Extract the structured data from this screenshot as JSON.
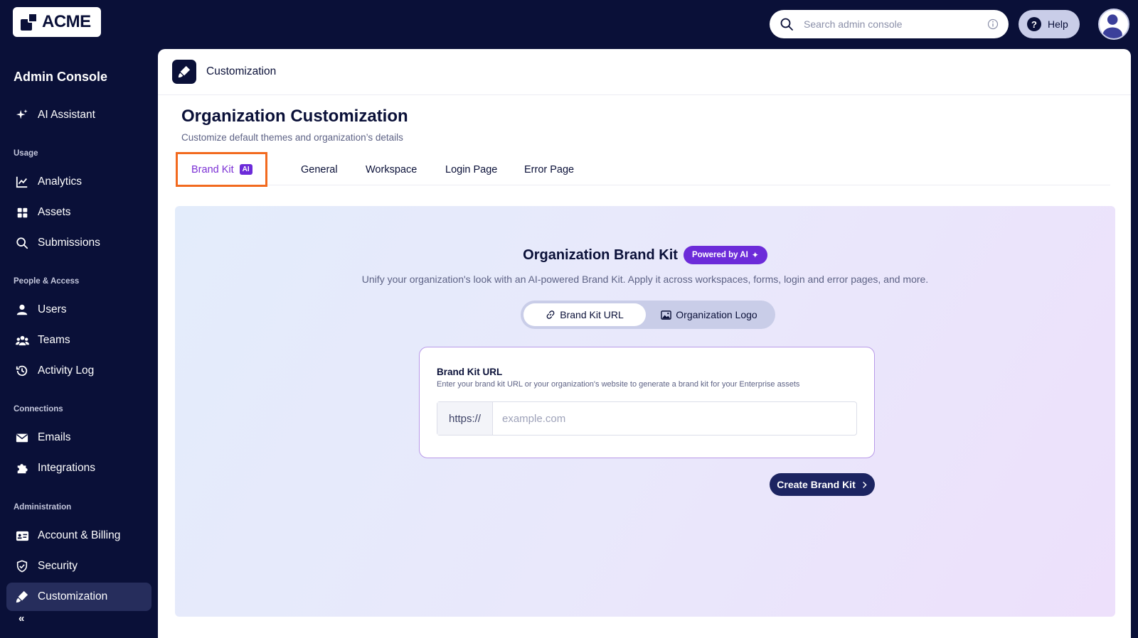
{
  "header": {
    "logo_text": "ACME",
    "search_placeholder": "Search admin console",
    "help_label": "Help"
  },
  "sidebar": {
    "title": "Admin Console",
    "top_item": "AI Assistant",
    "sections": {
      "usage": "Usage",
      "people": "People & Access",
      "connections": "Connections",
      "administration": "Administration"
    },
    "items": {
      "analytics": "Analytics",
      "assets": "Assets",
      "submissions": "Submissions",
      "users": "Users",
      "teams": "Teams",
      "activity_log": "Activity Log",
      "emails": "Emails",
      "integrations": "Integrations",
      "account_billing": "Account & Billing",
      "security": "Security",
      "customization": "Customization"
    }
  },
  "main": {
    "breadcrumb": "Customization",
    "title": "Organization Customization",
    "subtitle": "Customize default themes and organization’s details",
    "tabs": {
      "brand_kit": "Brand Kit",
      "brand_kit_badge": "AI",
      "general": "General",
      "workspace": "Workspace",
      "login_page": "Login Page",
      "error_page": "Error Page"
    },
    "brand_kit": {
      "title": "Organization Brand Kit",
      "powered_badge": "Powered by AI",
      "description": "Unify your organization's look with an AI-powered Brand Kit. Apply it across workspaces, forms, login and error pages, and more.",
      "segment_url": "Brand Kit URL",
      "segment_logo": "Organization Logo",
      "card_title": "Brand Kit URL",
      "card_desc": "Enter your brand kit URL or your organization's website to generate a brand kit for your Enterprise assets",
      "url_prefix": "https://",
      "url_placeholder": "example.com",
      "create_button": "Create Brand Kit"
    }
  }
}
